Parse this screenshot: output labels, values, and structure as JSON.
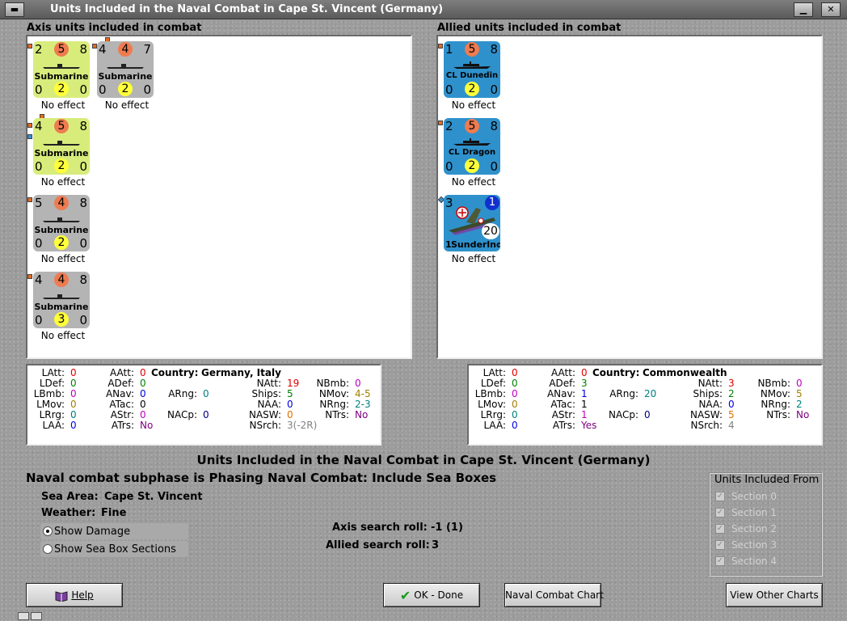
{
  "window": {
    "title": "Units Included in the Naval Combat in Cape St. Vincent (Germany)"
  },
  "axis_panel": {
    "label": "Axis units included in combat",
    "units": [
      {
        "name": "Submarine",
        "top_left": "2",
        "top_circle": "5",
        "top_right": "8",
        "bottom_left": "0",
        "bottom_circle": "2",
        "bottom_right": "0",
        "color": "yellowgreen",
        "effect": "No effect"
      },
      {
        "name": "Submarine",
        "top_left": "4",
        "top_circle": "4",
        "top_right": "7",
        "bottom_left": "0",
        "bottom_circle": "2",
        "bottom_right": "0",
        "color": "gray",
        "effect": "No effect"
      },
      {
        "name": "Submarine",
        "top_left": "4",
        "top_circle": "5",
        "top_right": "8",
        "bottom_left": "0",
        "bottom_circle": "2",
        "bottom_right": "0",
        "color": "yellowgreen",
        "effect": "No effect"
      },
      {
        "name": "Submarine",
        "top_left": "5",
        "top_circle": "4",
        "top_right": "8",
        "bottom_left": "0",
        "bottom_circle": "2",
        "bottom_right": "0",
        "color": "gray",
        "effect": "No effect"
      },
      {
        "name": "Submarine",
        "top_left": "4",
        "top_circle": "4",
        "top_right": "8",
        "bottom_left": "0",
        "bottom_circle": "3",
        "bottom_right": "0",
        "color": "gray",
        "effect": "No effect"
      }
    ]
  },
  "allied_panel": {
    "label": "Allied units included in combat",
    "units": [
      {
        "name": "CL Dunedin",
        "top_left": "1",
        "top_circle": "5",
        "top_right": "8",
        "bottom_left": "0",
        "bottom_circle": "2",
        "bottom_right": "0",
        "color": "blue",
        "effect": "No effect"
      },
      {
        "name": "CL Dragon",
        "top_left": "2",
        "top_circle": "5",
        "top_right": "8",
        "bottom_left": "0",
        "bottom_circle": "2",
        "bottom_right": "0",
        "color": "blue",
        "effect": "No effect"
      },
      {
        "name": "Sunderlnd",
        "prefix": "1",
        "top_left": "3",
        "badge": "1",
        "range": "20",
        "color": "blue",
        "effect": "No effect"
      }
    ]
  },
  "axis_stats": {
    "country_label": "Country:",
    "country": "Germany, Italy",
    "items": [
      {
        "label": "LAtt:",
        "value": "0",
        "color": "#e00000"
      },
      {
        "label": "LDef:",
        "value": "0",
        "color": "#008000"
      },
      {
        "label": "LBmb:",
        "value": "0",
        "color": "#c000c0"
      },
      {
        "label": "LMov:",
        "value": "0",
        "color": "#a08000"
      },
      {
        "label": "LRrg:",
        "value": "0",
        "color": "#008080"
      },
      {
        "label": "LAA:",
        "value": "0",
        "color": "#0000e0"
      },
      {
        "label": "AAtt:",
        "value": "0",
        "color": "#e00000"
      },
      {
        "label": "ADef:",
        "value": "0",
        "color": "#008000"
      },
      {
        "label": "ANav:",
        "value": "0",
        "color": "#0000e0"
      },
      {
        "label": "ATac:",
        "value": "0",
        "color": "#000000"
      },
      {
        "label": "AStr:",
        "value": "0",
        "color": "#c000c0"
      },
      {
        "label": "ATrs:",
        "value": "No",
        "color": "#800080"
      },
      {
        "label": "ARng:",
        "value": "0",
        "color": "#008080"
      },
      {
        "label": "NACp:",
        "value": "0",
        "color": "#000080"
      },
      {
        "label": "NAtt:",
        "value": "19",
        "color": "#e00000"
      },
      {
        "label": "Ships:",
        "value": "5",
        "color": "#008000"
      },
      {
        "label": "NAA:",
        "value": "0",
        "color": "#0000e0"
      },
      {
        "label": "NASW:",
        "value": "0",
        "color": "#e07000"
      },
      {
        "label": "NSrch:",
        "value": "3(-2R)",
        "color": "#808080"
      },
      {
        "label": "NBmb:",
        "value": "0",
        "color": "#c000c0"
      },
      {
        "label": "NMov:",
        "value": "4-5",
        "color": "#a08000"
      },
      {
        "label": "NRng:",
        "value": "2-3",
        "color": "#008080"
      },
      {
        "label": "NTrs:",
        "value": "No",
        "color": "#800080"
      }
    ]
  },
  "allied_stats": {
    "country_label": "Country:",
    "country": "Commonwealth",
    "items": [
      {
        "label": "LAtt:",
        "value": "0",
        "color": "#e00000"
      },
      {
        "label": "LDef:",
        "value": "0",
        "color": "#008000"
      },
      {
        "label": "LBmb:",
        "value": "0",
        "color": "#c000c0"
      },
      {
        "label": "LMov:",
        "value": "0",
        "color": "#a08000"
      },
      {
        "label": "LRrg:",
        "value": "0",
        "color": "#008080"
      },
      {
        "label": "LAA:",
        "value": "0",
        "color": "#0000e0"
      },
      {
        "label": "AAtt:",
        "value": "0",
        "color": "#e00000"
      },
      {
        "label": "ADef:",
        "value": "3",
        "color": "#008000"
      },
      {
        "label": "ANav:",
        "value": "1",
        "color": "#0000e0"
      },
      {
        "label": "ATac:",
        "value": "1",
        "color": "#000000"
      },
      {
        "label": "AStr:",
        "value": "1",
        "color": "#c000c0"
      },
      {
        "label": "ATrs:",
        "value": "Yes",
        "color": "#800080"
      },
      {
        "label": "ARng:",
        "value": "20",
        "color": "#008080"
      },
      {
        "label": "NACp:",
        "value": "0",
        "color": "#000080"
      },
      {
        "label": "NAtt:",
        "value": "3",
        "color": "#e00000"
      },
      {
        "label": "Ships:",
        "value": "2",
        "color": "#008000"
      },
      {
        "label": "NAA:",
        "value": "0",
        "color": "#0000e0"
      },
      {
        "label": "NASW:",
        "value": "5",
        "color": "#e07000"
      },
      {
        "label": "NSrch:",
        "value": "4",
        "color": "#808080"
      },
      {
        "label": "NBmb:",
        "value": "0",
        "color": "#c000c0"
      },
      {
        "label": "NMov:",
        "value": "5",
        "color": "#a08000"
      },
      {
        "label": "NRng:",
        "value": "2",
        "color": "#008080"
      },
      {
        "label": "NTrs:",
        "value": "No",
        "color": "#800080"
      }
    ]
  },
  "combat": {
    "title": "Units Included in the Naval Combat in Cape St. Vincent (Germany)",
    "subphase": "Naval combat subphase is Phasing Naval Combat: Include Sea Boxes",
    "sea_area_label": "Sea Area:",
    "sea_area": "Cape St. Vincent",
    "weather_label": "Weather:",
    "weather": "Fine",
    "axis_search_label": "Axis search roll:",
    "axis_search": "-1 (1)",
    "allied_search_label": "Allied search roll:",
    "allied_search": "3"
  },
  "options": {
    "show_damage": "Show Damage",
    "show_sections": "Show Sea Box Sections"
  },
  "sections": {
    "title": "Units Included From",
    "items": [
      "Section 0",
      "Section 1",
      "Section 2",
      "Section 3",
      "Section 4"
    ]
  },
  "buttons": {
    "help": "Help",
    "ok": "OK - Done",
    "naval_chart": "Naval Combat Chart",
    "other_charts": "View Other Charts"
  }
}
